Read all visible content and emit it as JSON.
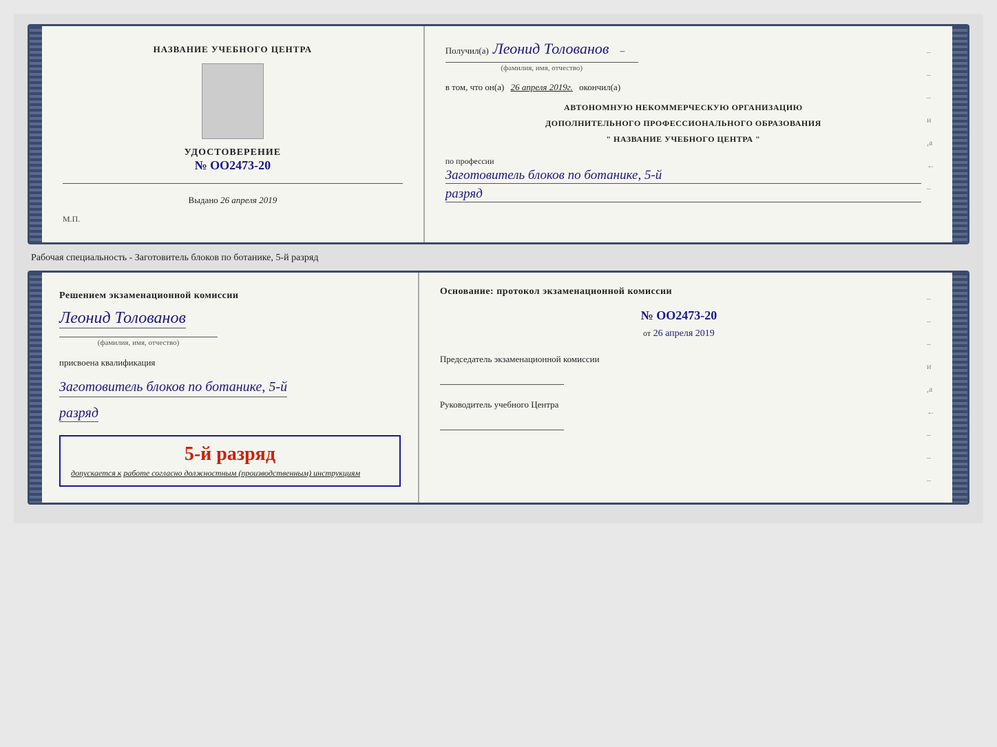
{
  "doc1": {
    "left": {
      "center_title": "НАЗВАНИЕ УЧЕБНОГО ЦЕНТРА",
      "cert_title": "УДОСТОВЕРЕНИЕ",
      "cert_number": "№ OO2473-20",
      "issued_label": "Выдано",
      "issued_date": "26 апреля 2019",
      "stamp_label": "М.П."
    },
    "right": {
      "recipient_prefix": "Получил(а)",
      "recipient_name": "Леонид Толованов",
      "recipient_sublabel": "(фамилия, имя, отчество)",
      "confirm_prefix": "в том, что он(а)",
      "confirm_date": "26 апреля 2019г.",
      "confirm_suffix": "окончил(а)",
      "org_line1": "АВТОНОМНУЮ НЕКОММЕРЧЕСКУЮ ОРГАНИЗАЦИЮ",
      "org_line2": "ДОПОЛНИТЕЛЬНОГО ПРОФЕССИОНАЛЬНОГО ОБРАЗОВАНИЯ",
      "org_line3": "\" НАЗВАНИЕ УЧЕБНОГО ЦЕНТРА \"",
      "profession_label": "по профессии",
      "profession_value": "Заготовитель блоков по ботанике, 5-й",
      "rank_value": "разряд",
      "dash1": "–",
      "dash2": "–",
      "dash3": "–",
      "dash4": "и",
      "dash5": ",а",
      "dash6": "←",
      "dash7": "–"
    }
  },
  "caption": {
    "text": "Рабочая специальность - Заготовитель блоков по ботанике, 5-й разряд"
  },
  "doc2": {
    "left": {
      "decision_text": "Решением экзаменационной комиссии",
      "name_value": "Леонид Толованов",
      "name_sublabel": "(фамилия, имя, отчество)",
      "qualification_label": "присвоена квалификация",
      "qualification_value": "Заготовитель блоков по ботанике, 5-й",
      "rank_value": "разряд",
      "badge_rank": "5-й разряд",
      "badge_prefix": "допускается к",
      "badge_desc": "работе согласно должностным (производственным) инструкциям"
    },
    "right": {
      "basis_title": "Основание: протокол экзаменационной комиссии",
      "protocol_number": "№  OO2473-20",
      "from_prefix": "от",
      "from_date": "26 апреля 2019",
      "chair_label": "Председатель экзаменационной комиссии",
      "head_label": "Руководитель учебного Центра",
      "dash1": "–",
      "dash2": "–",
      "dash3": "–",
      "dash4": "и",
      "dash5": ",а",
      "dash6": "←",
      "dash7": "–",
      "dash8": "–",
      "dash9": "–"
    }
  }
}
